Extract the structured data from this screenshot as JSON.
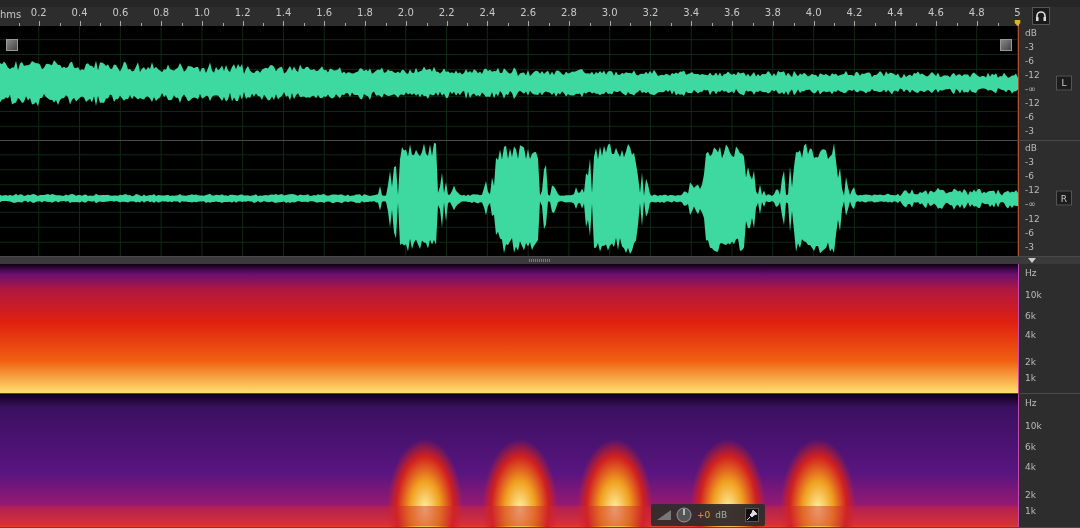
{
  "ruler": {
    "unit": "hms",
    "ticks": [
      "0.2",
      "0.4",
      "0.6",
      "0.8",
      "1.0",
      "1.2",
      "1.4",
      "1.6",
      "1.8",
      "2.0",
      "2.2",
      "2.4",
      "2.6",
      "2.8",
      "3.0",
      "3.2",
      "3.4",
      "3.6",
      "3.8",
      "4.0",
      "4.2",
      "4.4",
      "4.6",
      "4.8",
      "5"
    ]
  },
  "channels": [
    {
      "label": "L",
      "scale": [
        "dB",
        "-3",
        "-6",
        "-12",
        "-∞",
        "-12",
        "-6",
        "-3"
      ]
    },
    {
      "label": "R",
      "scale": [
        "dB",
        "-3",
        "-6",
        "-12",
        "-∞",
        "-12",
        "-6",
        "-3"
      ]
    }
  ],
  "spectrograms": [
    {
      "scale": [
        "Hz",
        "10k",
        "6k",
        "4k",
        "2k",
        "1k"
      ]
    },
    {
      "scale": [
        "Hz",
        "10k",
        "6k",
        "4k",
        "2k",
        "1k"
      ]
    }
  ],
  "hud": {
    "value": "+0",
    "unit": "dB"
  }
}
